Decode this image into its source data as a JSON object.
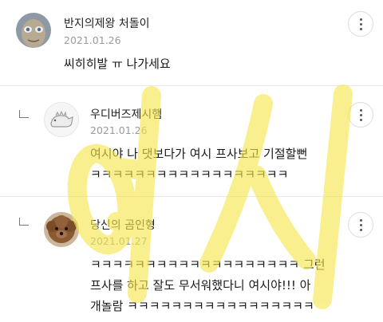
{
  "comments": [
    {
      "nickname": "반지의제왕 처돌이",
      "date": "2021.01.26",
      "lines": [
        "씨히히발 ㅠ 나가세요"
      ],
      "avatar_icon": "gollum-avatar-icon"
    },
    {
      "nickname": "우디버즈제시햄",
      "date": "2021.01.26",
      "lines": [
        "여시야 나 댓보다가 여시 프사보고 기절할뻔",
        "ㅋㅋㅋㅋㅋㅋㅋㅋㅋㅋㅋㅋㅋㅋㅋㅋㅋㅋ"
      ],
      "avatar_icon": "dinosaur-avatar-icon"
    },
    {
      "nickname": "당신의 곰인형",
      "date": "2021.01.27",
      "lines": [
        "ㅋㅋㅋㅋㅋㅋㅋㅋㅋㅋㅋㅋㅋㅋㅋㅋㅋㅋㅋ 그런",
        "프사를 하고 잘도 무서워했다니 여시야!!! 아",
        "개놀람 ㅋㅋㅋㅋㅋㅋㅋㅋㅋㅋㅋㅋㅋㅋㅋㅋㅋ"
      ],
      "avatar_icon": "poodle-avatar-icon"
    }
  ],
  "watermark": {
    "text": "여시",
    "color": "#f7e64a"
  },
  "icons": {
    "more": "more-options-icon",
    "reply": "reply-arrow-icon"
  }
}
